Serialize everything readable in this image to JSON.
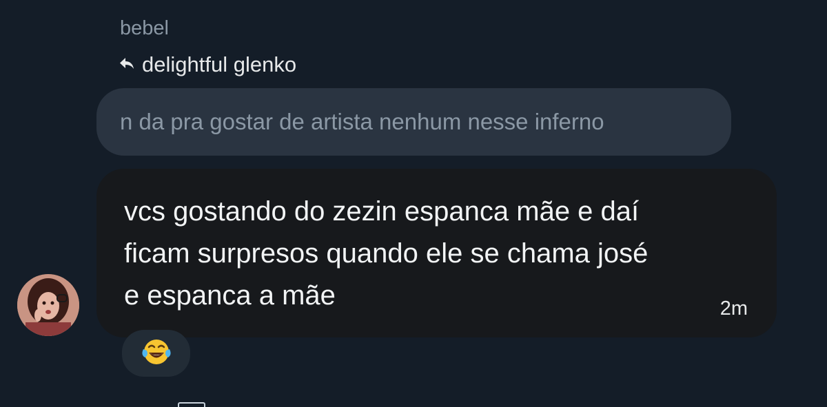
{
  "sender": {
    "name": "bebel"
  },
  "reply": {
    "label": "delightful glenko",
    "icon": "reply-arrow-icon"
  },
  "quoted_message": {
    "text": "n da pra gostar de artista nenhum nesse inferno"
  },
  "message": {
    "text_lines": [
      "vcs gostando do zezin espanca mãe e daí",
      "ficam surpresos quando ele se chama josé",
      "e espanca a mãe"
    ],
    "timestamp": "2m"
  },
  "reaction": {
    "emoji": "face-with-tears-of-joy-icon"
  },
  "colors": {
    "background": "#141d28",
    "quoted_bubble": "#2a3441",
    "message_bubble": "#17191c",
    "muted_text": "#8b98a5",
    "text": "#f2f4f5",
    "reaction_pill": "#222c36"
  }
}
